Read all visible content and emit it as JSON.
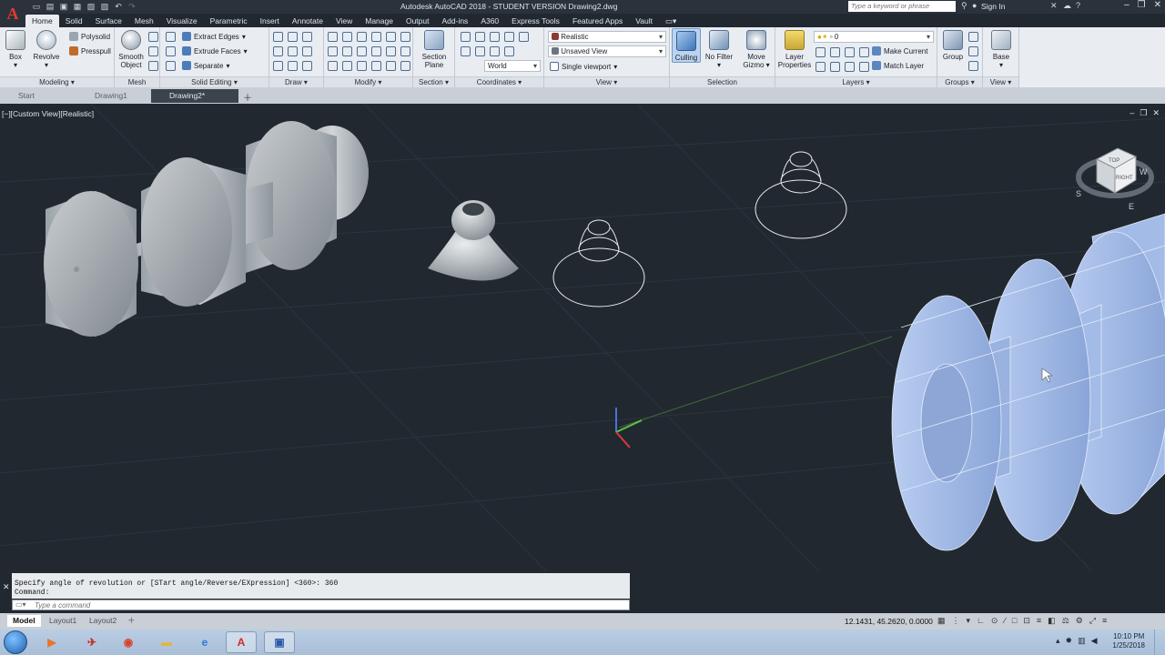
{
  "app": {
    "title": "Autodesk AutoCAD 2018 - STUDENT VERSION    Drawing2.dwg",
    "logo": "A",
    "search_placeholder": "Type a keyword or phrase",
    "signin": "Sign In"
  },
  "ribbon_tabs": [
    "Home",
    "Solid",
    "Surface",
    "Mesh",
    "Visualize",
    "Parametric",
    "Insert",
    "Annotate",
    "View",
    "Manage",
    "Output",
    "Add-ins",
    "A360",
    "Express Tools",
    "Featured Apps",
    "Vault"
  ],
  "ribbon": {
    "modeling": {
      "title": "Modeling",
      "box": "Box",
      "revolve": "Revolve",
      "polysolid": "Polysolid",
      "presspull": "Presspull"
    },
    "mesh": {
      "title": "Mesh",
      "smooth": "Smooth",
      "object": "Object"
    },
    "solid_editing": {
      "title": "Solid Editing",
      "extract": "Extract Edges",
      "extrude": "Extrude Faces",
      "separate": "Separate"
    },
    "draw": {
      "title": "Draw"
    },
    "modify": {
      "title": "Modify"
    },
    "section": {
      "title": "Section",
      "plane1": "Section",
      "plane2": "Plane"
    },
    "coordinates": {
      "title": "Coordinates",
      "world": "World"
    },
    "view": {
      "title": "View",
      "visual_style": "Realistic",
      "saved_view": "Unsaved View",
      "viewport": "Single viewport"
    },
    "selection": {
      "title": "Selection",
      "culling": "Culling",
      "nofilter": "No Filter",
      "move1": "Move",
      "move2": "Gizmo"
    },
    "layers": {
      "title": "Layers",
      "props1": "Layer",
      "props2": "Properties",
      "layer_value": "0",
      "make_current": "Make Current",
      "match_layer": "Match Layer"
    },
    "groups": {
      "title": "Groups",
      "group": "Group"
    },
    "viewpanel2": {
      "title": "View",
      "base": "Base"
    }
  },
  "file_tabs": [
    "Start",
    "Drawing1",
    "Drawing2*"
  ],
  "viewport": {
    "label": "[−][Custom View][Realistic]",
    "viewcube_top": "TOP",
    "viewcube_right": "RIGHT",
    "compass_s": "S",
    "compass_e": "E",
    "compass_w": "W"
  },
  "command": {
    "history_line1": "Specify angle of revolution or [STart angle/Reverse/EXpression] <360>: 360",
    "history_line2": "Command:",
    "placeholder": "Type a command"
  },
  "layout_tabs": [
    "Model",
    "Layout1",
    "Layout2"
  ],
  "status": {
    "coords": "12.1431, 45.2620, 0.0000"
  },
  "taskbar": {
    "time": "10:10 PM",
    "date": "1/25/2018"
  },
  "colors": {
    "viewport_bg": "#212830",
    "ribbon_bg": "#e9edf2",
    "accent_red": "#e03b30",
    "selected_blue": "#9fb8e6"
  }
}
